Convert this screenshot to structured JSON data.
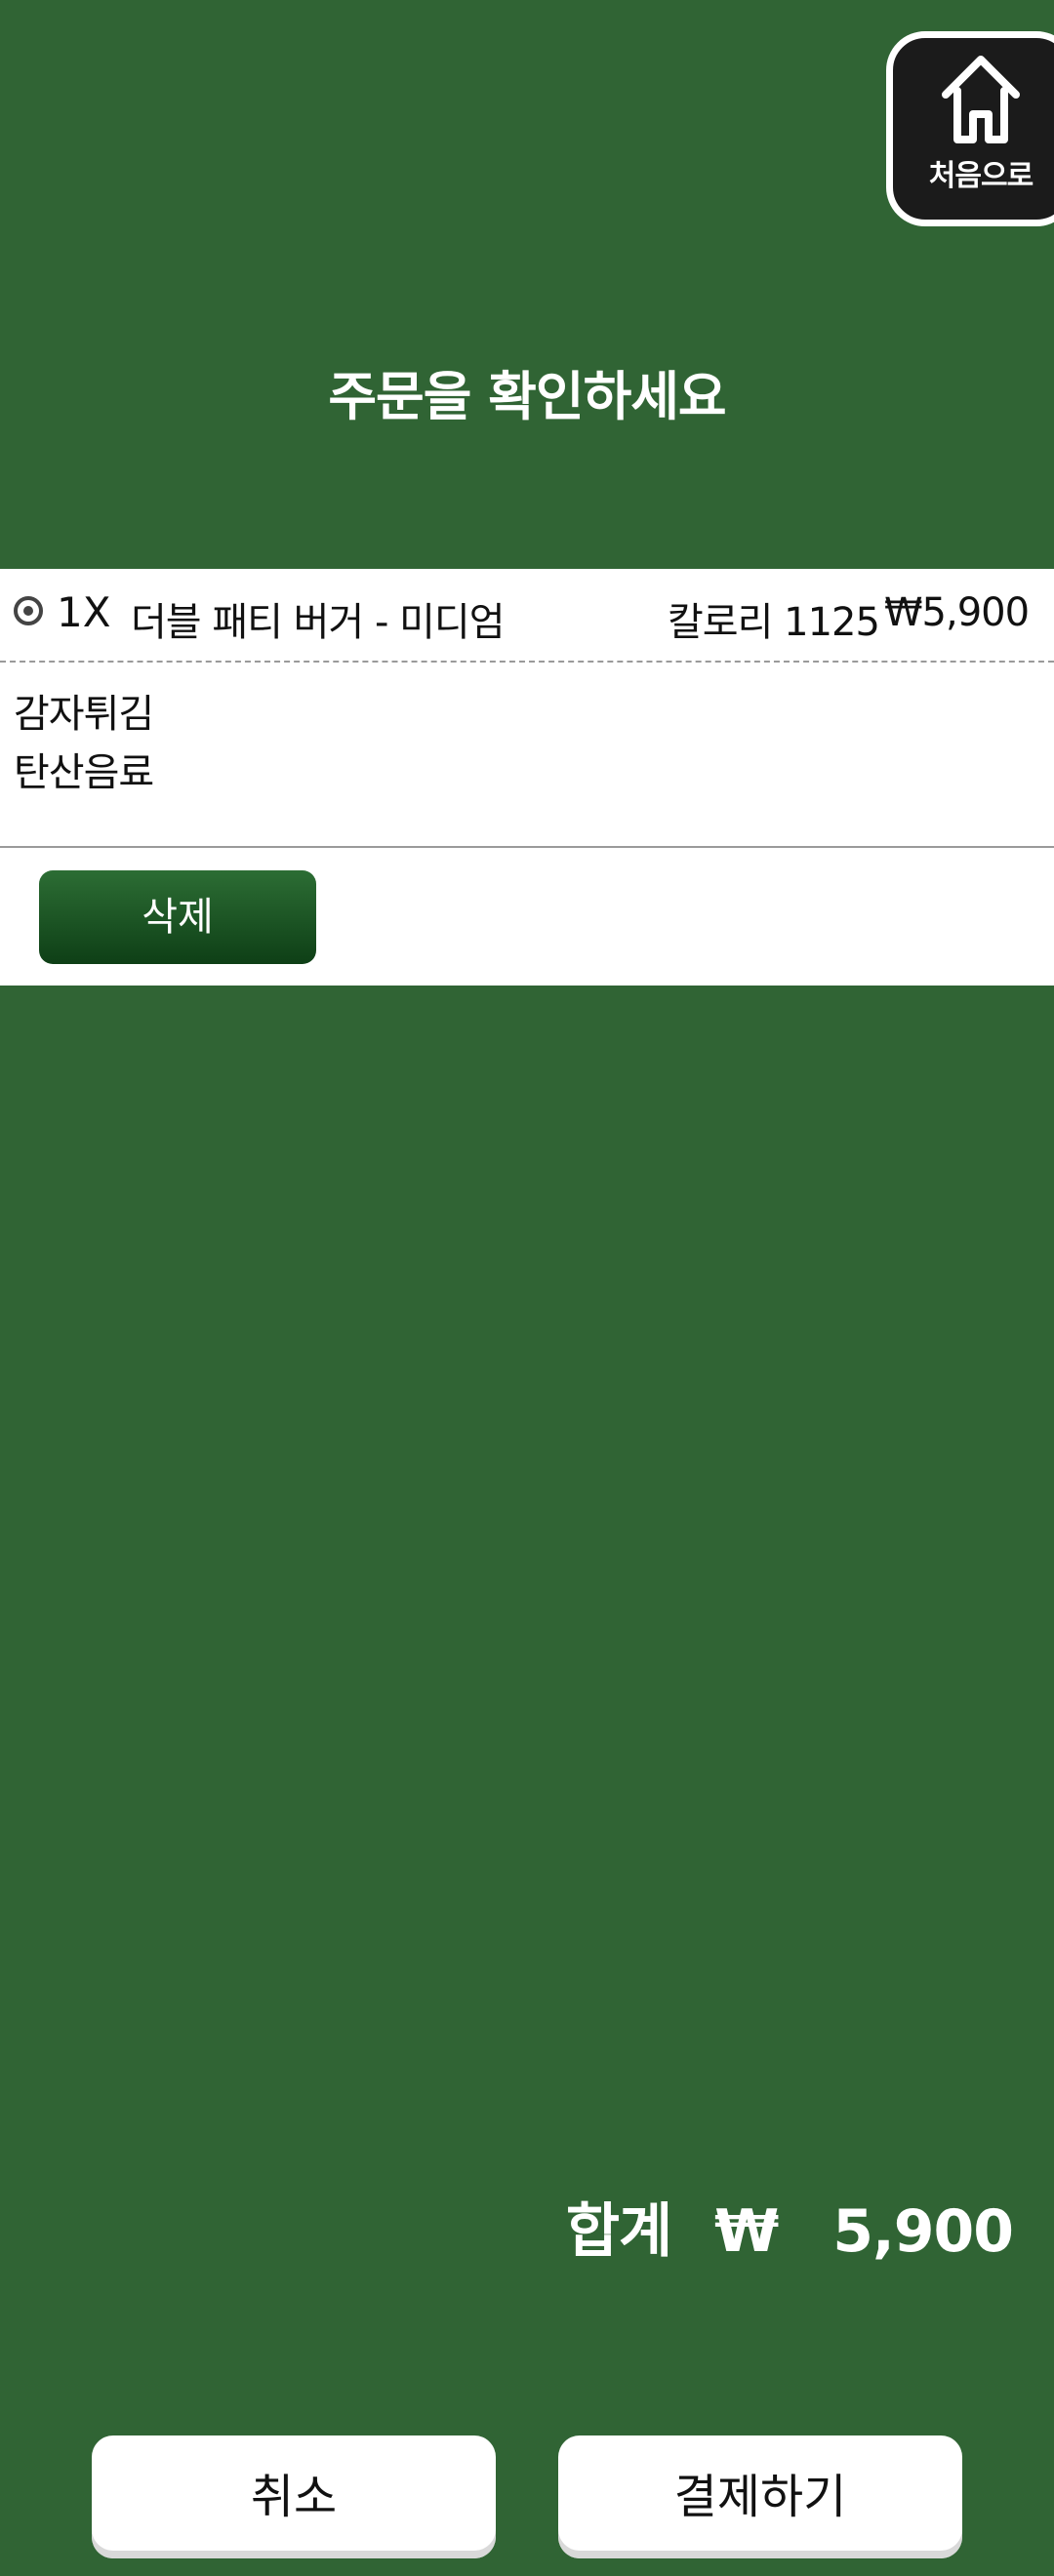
{
  "header": {
    "home_label": "처음으로",
    "title": "주문을 확인하세요"
  },
  "order": {
    "items": [
      {
        "qty": "1X",
        "name": "더블 패티 버거 - 미디엄",
        "calorie": "칼로리 1125",
        "price": "₩5,900",
        "options": [
          "감자튀김",
          "탄산음료"
        ]
      }
    ],
    "delete_label": "삭제"
  },
  "total": {
    "label": "합계",
    "currency": "₩",
    "amount": "5,900"
  },
  "actions": {
    "cancel_label": "취소",
    "pay_label": "결제하기"
  },
  "colors": {
    "background": "#306434",
    "delete_button": "#1d5a26",
    "home_button": "#1b1b1b"
  }
}
